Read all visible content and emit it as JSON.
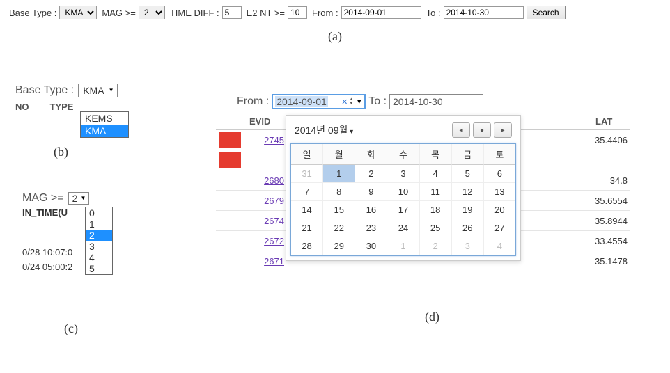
{
  "panel_a": {
    "base_type_label": "Base Type :",
    "base_type_value": "KMA",
    "mag_label": "MAG >=",
    "mag_value": "2",
    "timediff_label": "TIME DIFF :",
    "timediff_value": "5",
    "e2nt_label": "E2 NT >=",
    "e2nt_value": "10",
    "from_label": "From :",
    "from_value": "2014-09-01",
    "to_label": "To :",
    "to_value": "2014-10-30",
    "search_label": "Search",
    "caption": "(a)"
  },
  "panel_b": {
    "base_type_label": "Base Type :",
    "selected": "KMA",
    "options": [
      "KEMS",
      "KMA"
    ],
    "highlighted": "KMA",
    "headers": [
      "NO",
      "TYPE"
    ],
    "caption": "(b)"
  },
  "panel_c": {
    "mag_label": "MAG >=",
    "selected": "2",
    "options": [
      "0",
      "1",
      "2",
      "3",
      "4",
      "5"
    ],
    "highlighted": "2",
    "header": "IN_TIME(U",
    "rows": [
      "0/28 10:07:0",
      "0/24 05:00:2"
    ],
    "caption": "(c)"
  },
  "panel_d": {
    "from_label": "From :",
    "from_value": "2014-09-01",
    "to_label": "To :",
    "to_value": "2014-10-30",
    "bg_headers": {
      "evid": "EVID",
      "lat": "LAT"
    },
    "bg_rows": [
      {
        "evid": "2745",
        "red": true,
        "lat": "35.4406"
      },
      {
        "evid": "",
        "red": true,
        "lat": ""
      },
      {
        "evid": "2680",
        "red": false,
        "lat": "34.8"
      },
      {
        "evid": "2679",
        "red": false,
        "lat": "35.6554"
      },
      {
        "evid": "2674",
        "red": false,
        "lat": "35.8944"
      },
      {
        "evid": "2672",
        "red": false,
        "lat": "33.4554"
      },
      {
        "evid": "2671",
        "red": false,
        "lat": "35.1478"
      }
    ],
    "calendar": {
      "month_label": "2014년 09월",
      "day_headers": [
        "일",
        "월",
        "화",
        "수",
        "목",
        "금",
        "토"
      ],
      "weeks": [
        [
          {
            "d": "31",
            "o": true
          },
          {
            "d": "1",
            "sel": true
          },
          {
            "d": "2"
          },
          {
            "d": "3"
          },
          {
            "d": "4"
          },
          {
            "d": "5"
          },
          {
            "d": "6"
          }
        ],
        [
          {
            "d": "7"
          },
          {
            "d": "8"
          },
          {
            "d": "9"
          },
          {
            "d": "10"
          },
          {
            "d": "11"
          },
          {
            "d": "12"
          },
          {
            "d": "13"
          }
        ],
        [
          {
            "d": "14"
          },
          {
            "d": "15"
          },
          {
            "d": "16"
          },
          {
            "d": "17"
          },
          {
            "d": "18"
          },
          {
            "d": "19"
          },
          {
            "d": "20"
          }
        ],
        [
          {
            "d": "21"
          },
          {
            "d": "22"
          },
          {
            "d": "23"
          },
          {
            "d": "24"
          },
          {
            "d": "25"
          },
          {
            "d": "26"
          },
          {
            "d": "27"
          }
        ],
        [
          {
            "d": "28"
          },
          {
            "d": "29"
          },
          {
            "d": "30"
          },
          {
            "d": "1",
            "o": true
          },
          {
            "d": "2",
            "o": true
          },
          {
            "d": "3",
            "o": true
          },
          {
            "d": "4",
            "o": true
          }
        ]
      ]
    },
    "nav_icons": {
      "prev": "◂",
      "today": "●",
      "next": "▸"
    },
    "caption": "(d)"
  }
}
